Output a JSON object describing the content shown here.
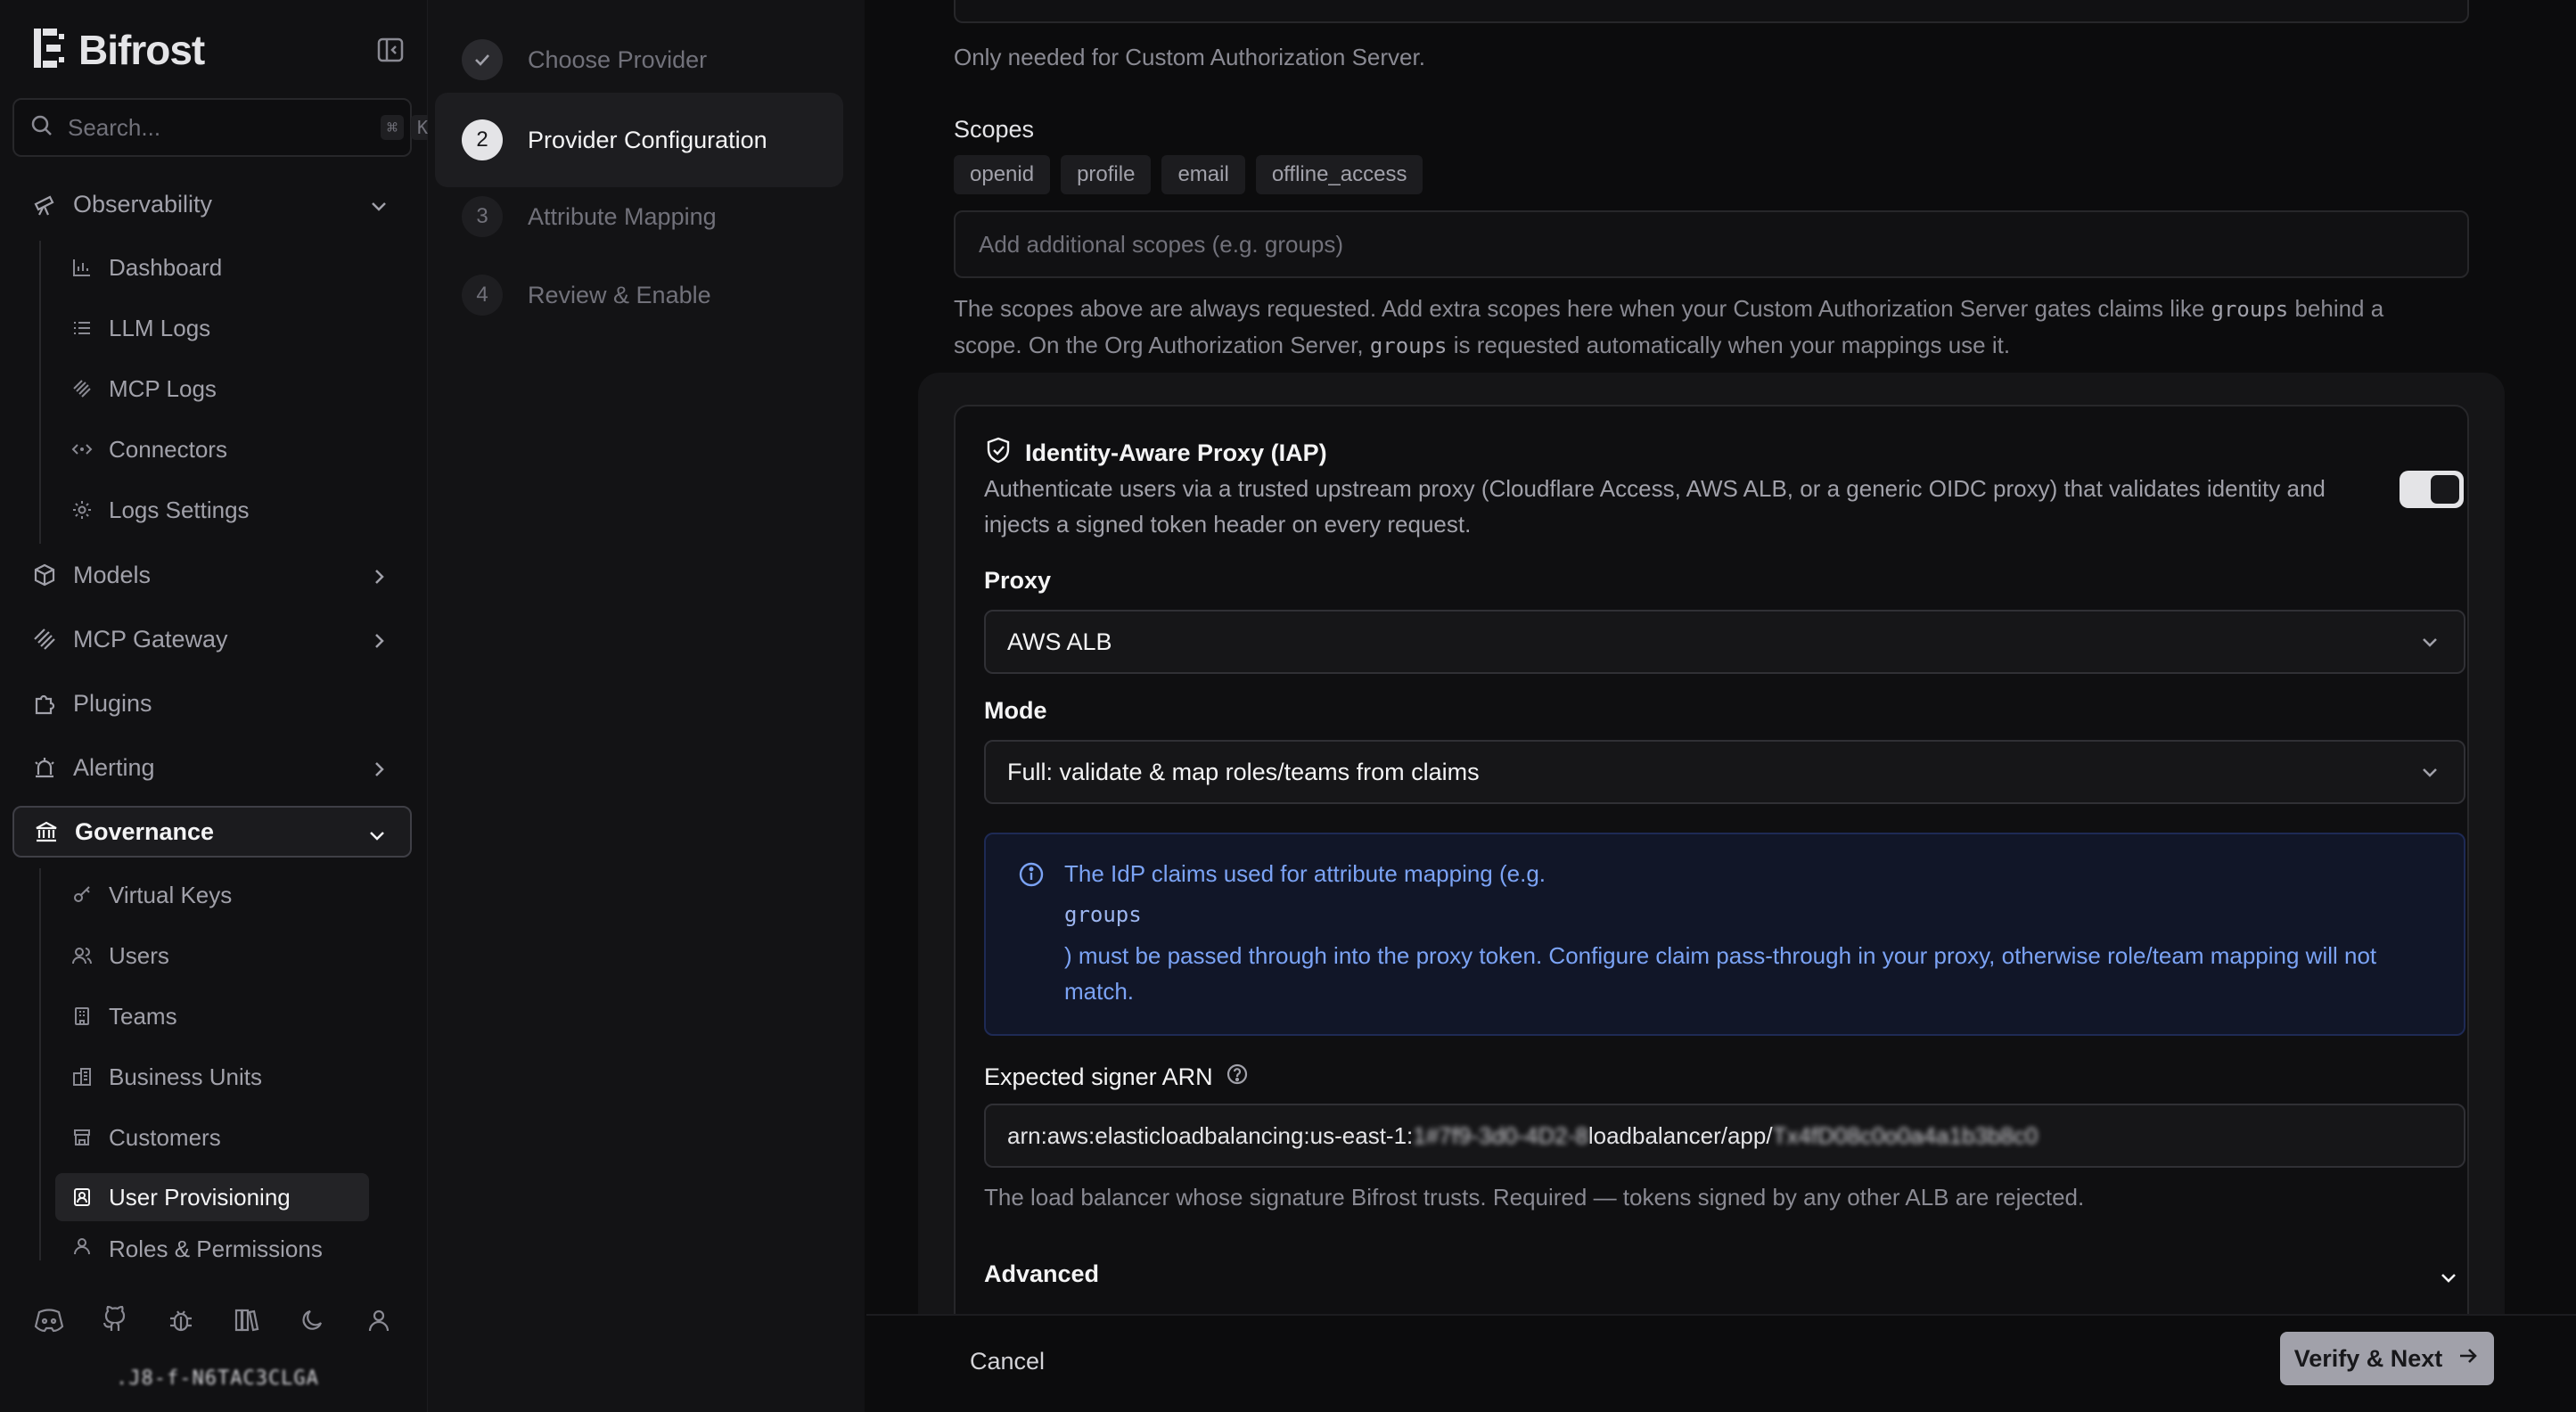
{
  "app": {
    "name": "Bifrost"
  },
  "search": {
    "placeholder": "Search...",
    "kbd_mod": "⌘",
    "kbd_key": "K"
  },
  "sidebar": {
    "observability": "Observability",
    "observability_items": [
      "Dashboard",
      "LLM Logs",
      "MCP Logs",
      "Connectors",
      "Logs Settings"
    ],
    "models": "Models",
    "mcp_gateway": "MCP Gateway",
    "plugins": "Plugins",
    "alerting": "Alerting",
    "governance": "Governance",
    "governance_items": [
      "Virtual Keys",
      "Users",
      "Teams",
      "Business Units",
      "Customers",
      "User Provisioning",
      "Roles & Permissions"
    ],
    "version": ".J8-f-N6TAC3CLGA"
  },
  "stepper": {
    "steps": [
      {
        "num": "✓",
        "label": "Choose Provider"
      },
      {
        "num": "2",
        "label": "Provider Configuration"
      },
      {
        "num": "3",
        "label": "Attribute Mapping"
      },
      {
        "num": "4",
        "label": "Review & Enable"
      }
    ]
  },
  "main": {
    "custom_auth_hint": "Only needed for Custom Authorization Server.",
    "scopes_label": "Scopes",
    "scopes": [
      "openid",
      "profile",
      "email",
      "offline_access"
    ],
    "scopes_placeholder": "Add additional scopes (e.g. groups)",
    "scopes_hint_1": "The scopes above are always requested. Add extra scopes here when your Custom Authorization Server gates claims like ",
    "scopes_hint_code1": "groups",
    "scopes_hint_2": " behind a",
    "scopes_hint_3": "scope. On the Org Authorization Server, ",
    "scopes_hint_code2": "groups",
    "scopes_hint_4": " is requested automatically when your mappings use it.",
    "iap": {
      "title": "Identity-Aware Proxy (IAP)",
      "description": "Authenticate users via a trusted upstream proxy (Cloudflare Access, AWS ALB, or a generic OIDC proxy) that validates identity and injects a signed token header on every request.",
      "enabled": true,
      "proxy_label": "Proxy",
      "proxy_value": "AWS ALB",
      "mode_label": "Mode",
      "mode_value": "Full: validate & map roles/teams from claims",
      "info_1": "The IdP claims used for attribute mapping (e.g.",
      "info_code": "groups",
      "info_2": ") must be passed through into the proxy token. Configure claim pass-through in your proxy, otherwise role/team mapping will not match.",
      "arn_label": "Expected signer ARN",
      "arn_prefix": "arn:aws:elasticloadbalancing:us-east-1:",
      "arn_blur1": "1#7f9-3d0-4D2-8",
      "arn_mid": "loadbalancer/app/",
      "arn_blur2": "Tx4fD08c0o0a4a1b3b8c0",
      "arn_hint": "The load balancer whose signature Bifrost trusts. Required — tokens signed by any other ALB are rejected.",
      "advanced_label": "Advanced"
    },
    "cancel": "Cancel",
    "next": "Verify & Next"
  }
}
